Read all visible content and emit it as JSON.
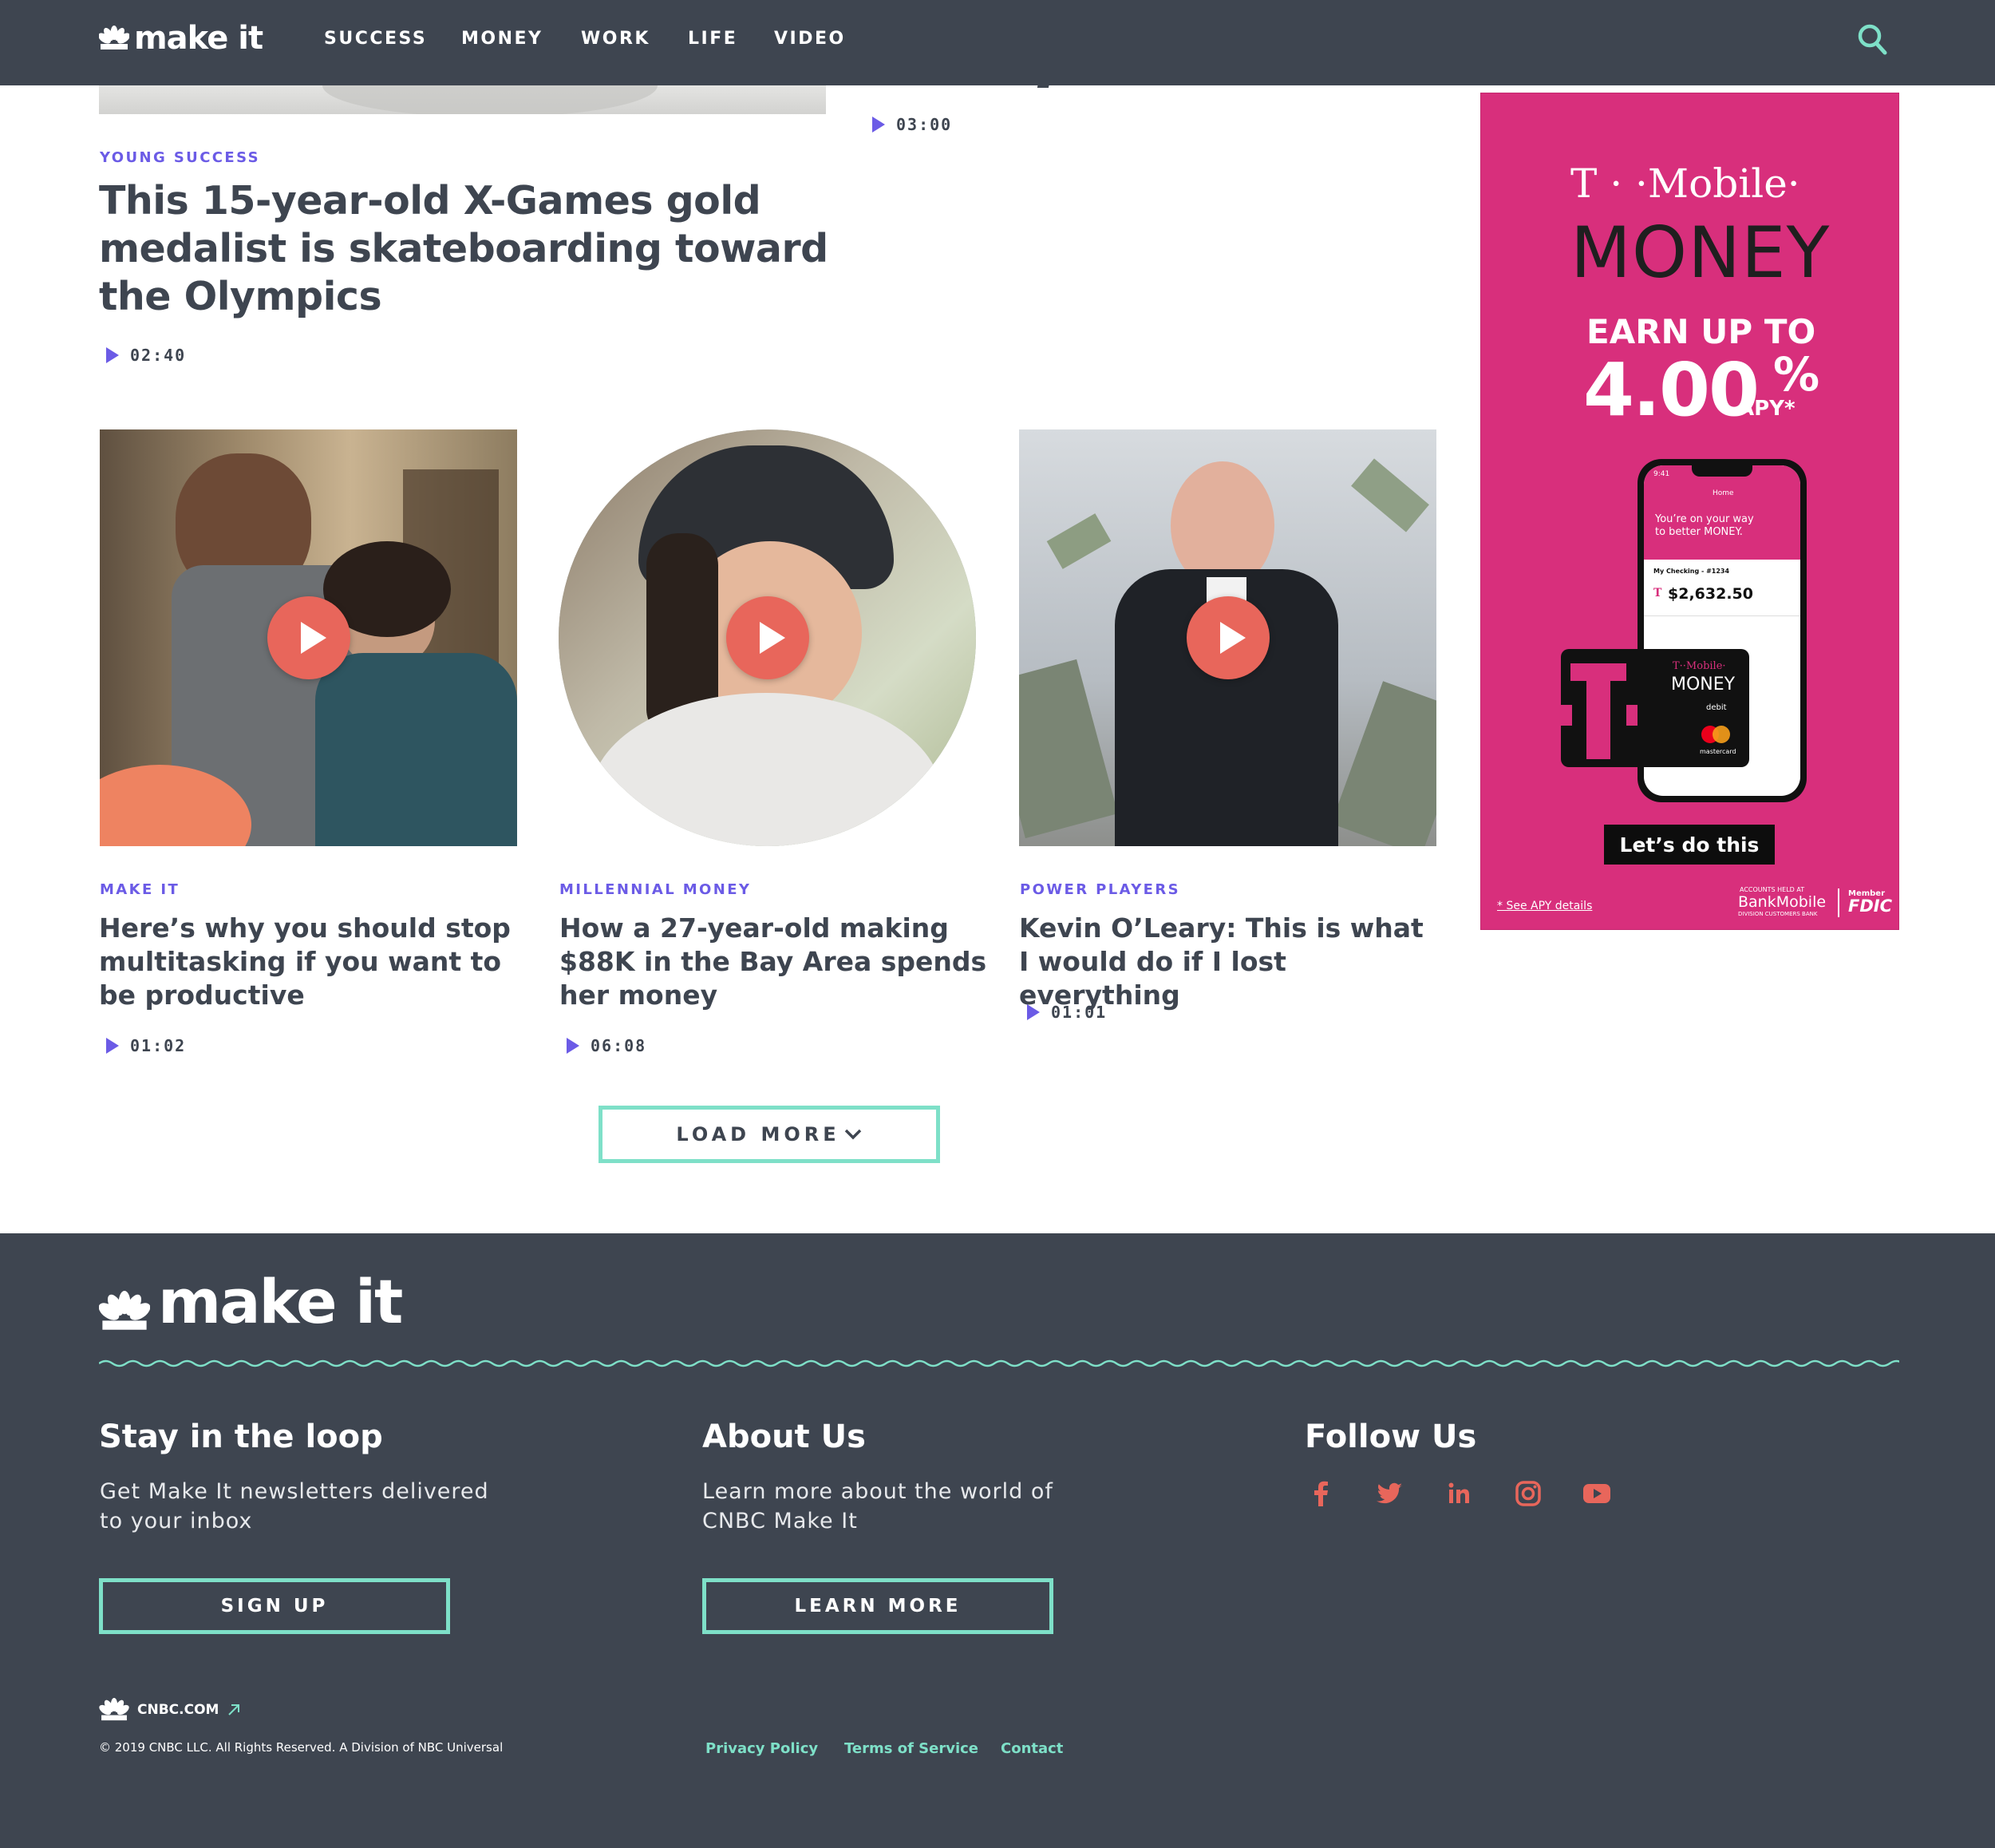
{
  "header": {
    "logo_text": "make it",
    "nav": [
      "SUCCESS",
      "MONEY",
      "WORK",
      "LIFE",
      "VIDEO"
    ]
  },
  "top_video": {
    "duration": "03:00"
  },
  "feature": {
    "kicker": "YOUNG SUCCESS",
    "title": "This 15-year-old X-Games gold medalist is skateboarding toward the Olympics",
    "duration": "02:40"
  },
  "cards": [
    {
      "kicker": "MAKE IT",
      "title": "Here’s why you should stop multitasking if you want to be productive",
      "duration": "01:02"
    },
    {
      "kicker": "MILLENNIAL MONEY",
      "title": "How a 27-year-old making $88K in the Bay Area spends her money",
      "duration": "06:08"
    },
    {
      "kicker": "POWER PLAYERS",
      "title": "Kevin O’Leary: This is what I would do if I lost everything",
      "duration": "01:01"
    }
  ],
  "load_more": "LOAD MORE",
  "ad": {
    "brand": "T · ·Mobile·",
    "product": "MONEY",
    "earn": "EARN UP TO",
    "rate": "4.00",
    "percent": "%",
    "apy": "APY*",
    "phone_greeting_1": "You’re on your way",
    "phone_greeting_2": "to better MONEY.",
    "phone_account": "My Checking - #1234",
    "phone_balance": "$2,632.50",
    "phone_home": "Home",
    "phone_time": "9:41",
    "card_brand": "T··Mobile·",
    "card_product": "MONEY",
    "card_debit": "debit",
    "card_network": "mastercard",
    "cta": "Let’s do this",
    "apy_details": "* See APY details",
    "accounts_held": "ACCOUNTS HELD AT",
    "bank": "BankMobile",
    "bank_division": "DIVISION CUSTOMERS BANK",
    "member": "Member",
    "fdic": "FDIC",
    "colors": {
      "background": "#d82f7c"
    }
  },
  "footer": {
    "logo_text": "make it",
    "newsletter": {
      "heading": "Stay in the loop",
      "line1": "Get Make It newsletters delivered",
      "line2": "to your inbox",
      "button": "SIGN UP"
    },
    "about": {
      "heading": "About Us",
      "line1": "Learn more about the world of",
      "line2": "CNBC Make It",
      "button": "LEARN MORE"
    },
    "follow": {
      "heading": "Follow Us",
      "icons": [
        "facebook-icon",
        "twitter-icon",
        "linkedin-icon",
        "instagram-icon",
        "youtube-icon"
      ]
    },
    "cnbc_link": "CNBC.COM",
    "copyright": "© 2019 CNBC LLC. All Rights Reserved. A Division of NBC Universal",
    "links": [
      "Privacy Policy",
      "Terms of Service",
      "Contact"
    ]
  },
  "colors": {
    "header_bg": "#3e4550",
    "accent_purple": "#6b5be6",
    "accent_teal": "#7ee0c8",
    "play_coral": "#e8665b"
  }
}
